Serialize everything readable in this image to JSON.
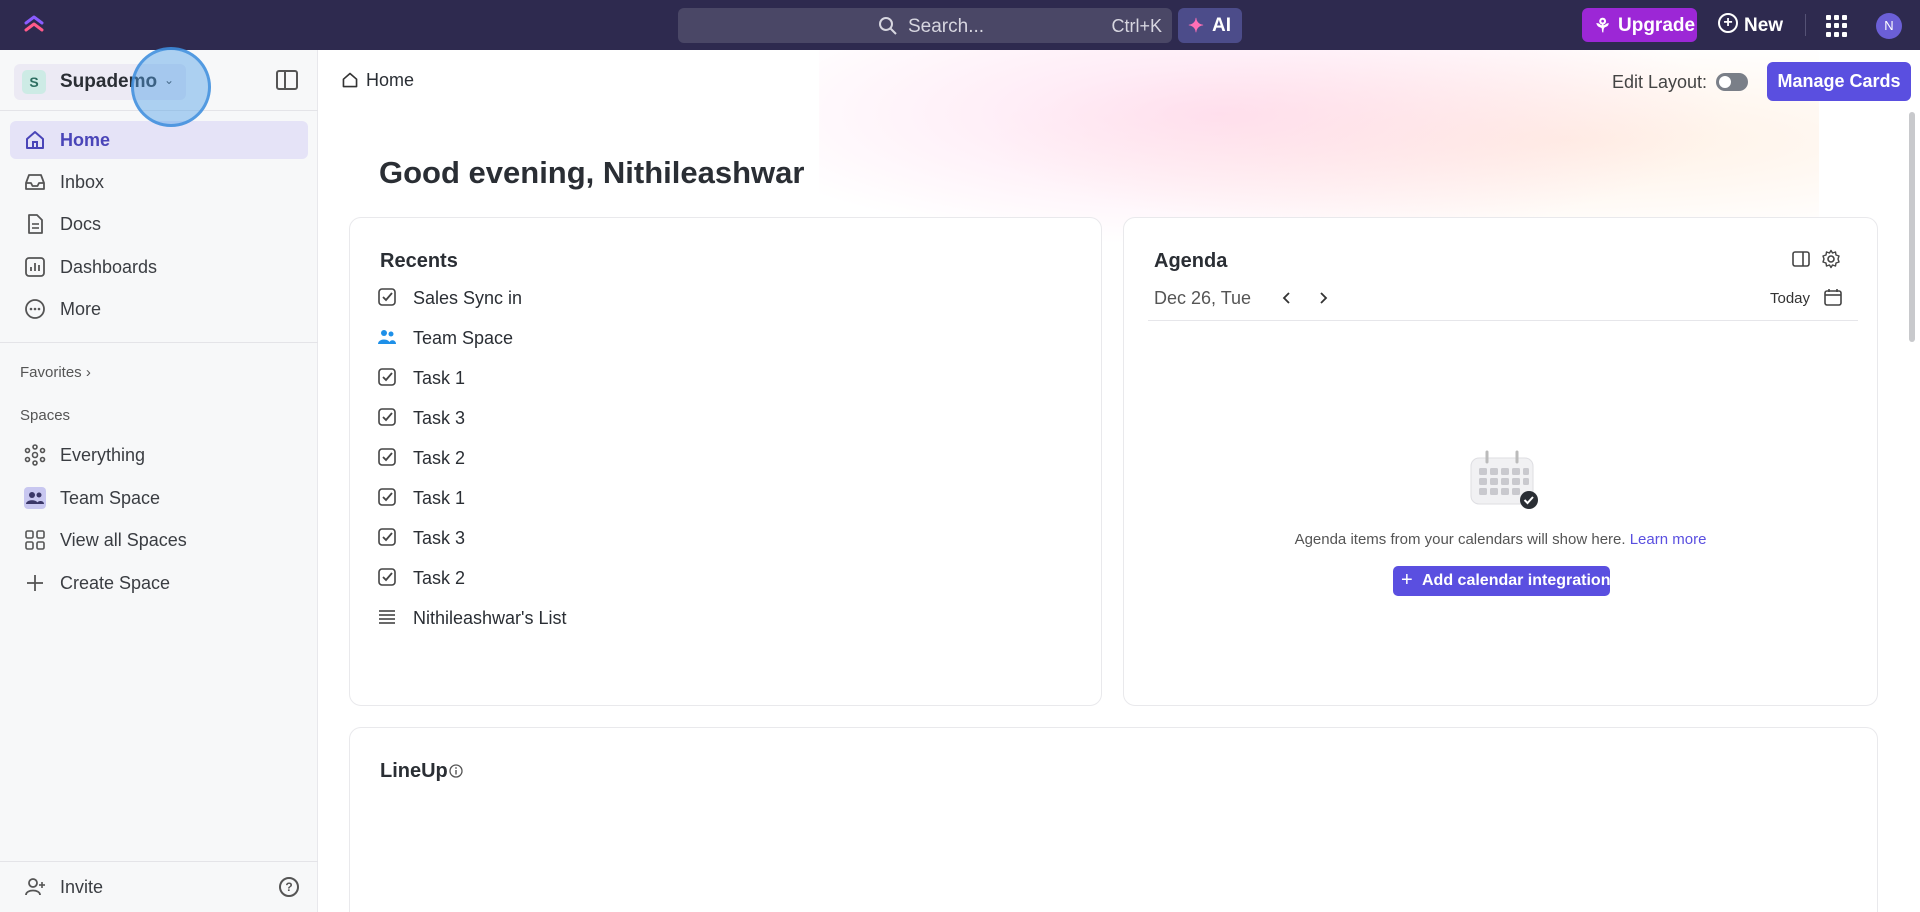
{
  "topbar": {
    "search_placeholder": "Search...",
    "search_shortcut": "Ctrl+K",
    "ai_label": "AI",
    "upgrade_label": "Upgrade",
    "new_label": "New",
    "avatar_initial": "N"
  },
  "sidebar": {
    "workspace_initial": "S",
    "workspace_name": "Supademo",
    "nav": [
      {
        "label": "Home",
        "icon": "home-icon",
        "active": true
      },
      {
        "label": "Inbox",
        "icon": "inbox-icon"
      },
      {
        "label": "Docs",
        "icon": "docs-icon"
      },
      {
        "label": "Dashboards",
        "icon": "dashboards-icon"
      },
      {
        "label": "More",
        "icon": "more-icon"
      }
    ],
    "favorites_label": "Favorites",
    "spaces_label": "Spaces",
    "spaces": [
      {
        "label": "Everything",
        "icon": "everything-icon"
      },
      {
        "label": "Team Space",
        "icon": "team-space-icon"
      },
      {
        "label": "View all Spaces",
        "icon": "grid-icon"
      },
      {
        "label": "Create Space",
        "icon": "plus-icon"
      }
    ],
    "invite_label": "Invite"
  },
  "main": {
    "breadcrumb": "Home",
    "edit_layout_label": "Edit Layout:",
    "manage_cards_label": "Manage Cards",
    "greeting": "Good evening, Nithileashwar",
    "recents": {
      "title": "Recents",
      "items": [
        {
          "label": "Sales Sync in",
          "icon": "task-icon"
        },
        {
          "label": "Team Space",
          "icon": "team-icon"
        },
        {
          "label": "Task 1",
          "icon": "task-icon"
        },
        {
          "label": "Task 3",
          "icon": "task-icon"
        },
        {
          "label": "Task 2",
          "icon": "task-icon"
        },
        {
          "label": "Task 1",
          "icon": "task-icon"
        },
        {
          "label": "Task 3",
          "icon": "task-icon"
        },
        {
          "label": "Task 2",
          "icon": "task-icon"
        },
        {
          "label": "Nithileashwar's List",
          "icon": "list-icon"
        }
      ]
    },
    "agenda": {
      "title": "Agenda",
      "date": "Dec 26, Tue",
      "today_label": "Today",
      "empty_text": "Agenda items from your calendars will show here.",
      "learn_more": "Learn more",
      "add_integrations": "Add calendar integrations"
    },
    "lineup": {
      "title": "LineUp"
    }
  }
}
